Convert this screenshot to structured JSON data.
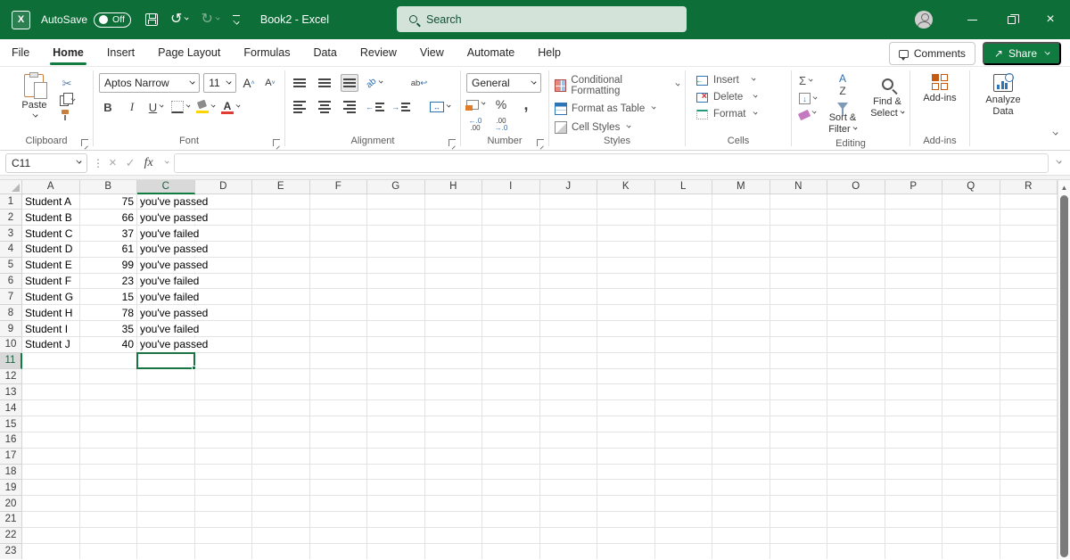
{
  "titlebar": {
    "app": "Excel",
    "autosave_label": "AutoSave",
    "autosave_state": "Off",
    "doc_title": "Book2 - Excel",
    "search_placeholder": "Search"
  },
  "tabs": {
    "items": [
      "File",
      "Home",
      "Insert",
      "Page Layout",
      "Formulas",
      "Data",
      "Review",
      "View",
      "Automate",
      "Help"
    ],
    "active": "Home",
    "comments_label": "Comments",
    "share_label": "Share"
  },
  "ribbon": {
    "clipboard": {
      "label": "Clipboard",
      "paste": "Paste"
    },
    "font": {
      "label": "Font",
      "font_name": "Aptos Narrow",
      "font_size": "11"
    },
    "alignment": {
      "label": "Alignment"
    },
    "number": {
      "label": "Number",
      "format": "General"
    },
    "styles": {
      "label": "Styles",
      "items": [
        "Conditional Formatting",
        "Format as Table",
        "Cell Styles"
      ]
    },
    "cells": {
      "label": "Cells",
      "items": [
        "Insert",
        "Delete",
        "Format"
      ]
    },
    "editing": {
      "label": "Editing",
      "sort_filter": "Sort & Filter",
      "find_select": "Find & Select"
    },
    "addins": {
      "label": "Add-ins",
      "button": "Add-ins"
    },
    "analyze": {
      "button": "Analyze Data"
    }
  },
  "formula_bar": {
    "name_box": "C11",
    "value": ""
  },
  "icons": {
    "cut": "✂",
    "bold": "B",
    "italic": "I",
    "underline": "U",
    "font_color_letter": "A",
    "increase_font": "A",
    "decrease_font": "A",
    "percent": "%",
    "comma": ",",
    "autosum": "Σ",
    "fill_down": "↓",
    "undo": "↺",
    "redo": "↻",
    "fx": "fx",
    "check": "✓",
    "cancel": "×",
    "dots": "⋮",
    "scroll_up": "▲",
    "share_arrow": "↗",
    "orientation": "ab",
    "wrap_a": "ab",
    "wrap_b": "↩",
    "merge_arrows": "↔",
    "dec_decimal": "←.0",
    "dec_decimal2": ".00",
    "inc_decimal": ".00",
    "inc_decimal2": "→.0",
    "indent_dec_arrow": "←",
    "indent_inc_arrow": "→",
    "az_a": "A",
    "az_z": "Z"
  },
  "sheet": {
    "columns": [
      "A",
      "B",
      "C",
      "D",
      "E",
      "F",
      "G",
      "H",
      "I",
      "J",
      "K",
      "L",
      "M",
      "N",
      "O",
      "P",
      "Q",
      "R"
    ],
    "visible_rows": 23,
    "selected_cell": {
      "col": "C",
      "row": 11
    },
    "rows": [
      {
        "A": "Student A",
        "B": "75",
        "C": "you've passed"
      },
      {
        "A": "Student B",
        "B": "66",
        "C": "you've passed"
      },
      {
        "A": "Student C",
        "B": "37",
        "C": "you've failed"
      },
      {
        "A": "Student D",
        "B": "61",
        "C": "you've passed"
      },
      {
        "A": "Student E",
        "B": "99",
        "C": "you've passed"
      },
      {
        "A": "Student F",
        "B": "23",
        "C": "you've failed"
      },
      {
        "A": "Student G",
        "B": "15",
        "C": "you've failed"
      },
      {
        "A": "Student H",
        "B": "78",
        "C": "you've passed"
      },
      {
        "A": "Student I",
        "B": "35",
        "C": "you've failed"
      },
      {
        "A": "Student J",
        "B": "40",
        "C": "you've passed"
      }
    ]
  },
  "colors": {
    "titlebar_green": "#0e6e38",
    "accent_green": "#107c41",
    "selection_border": "#1a7344",
    "fill_yellow": "#ffd400",
    "font_red": "#e03c31"
  }
}
